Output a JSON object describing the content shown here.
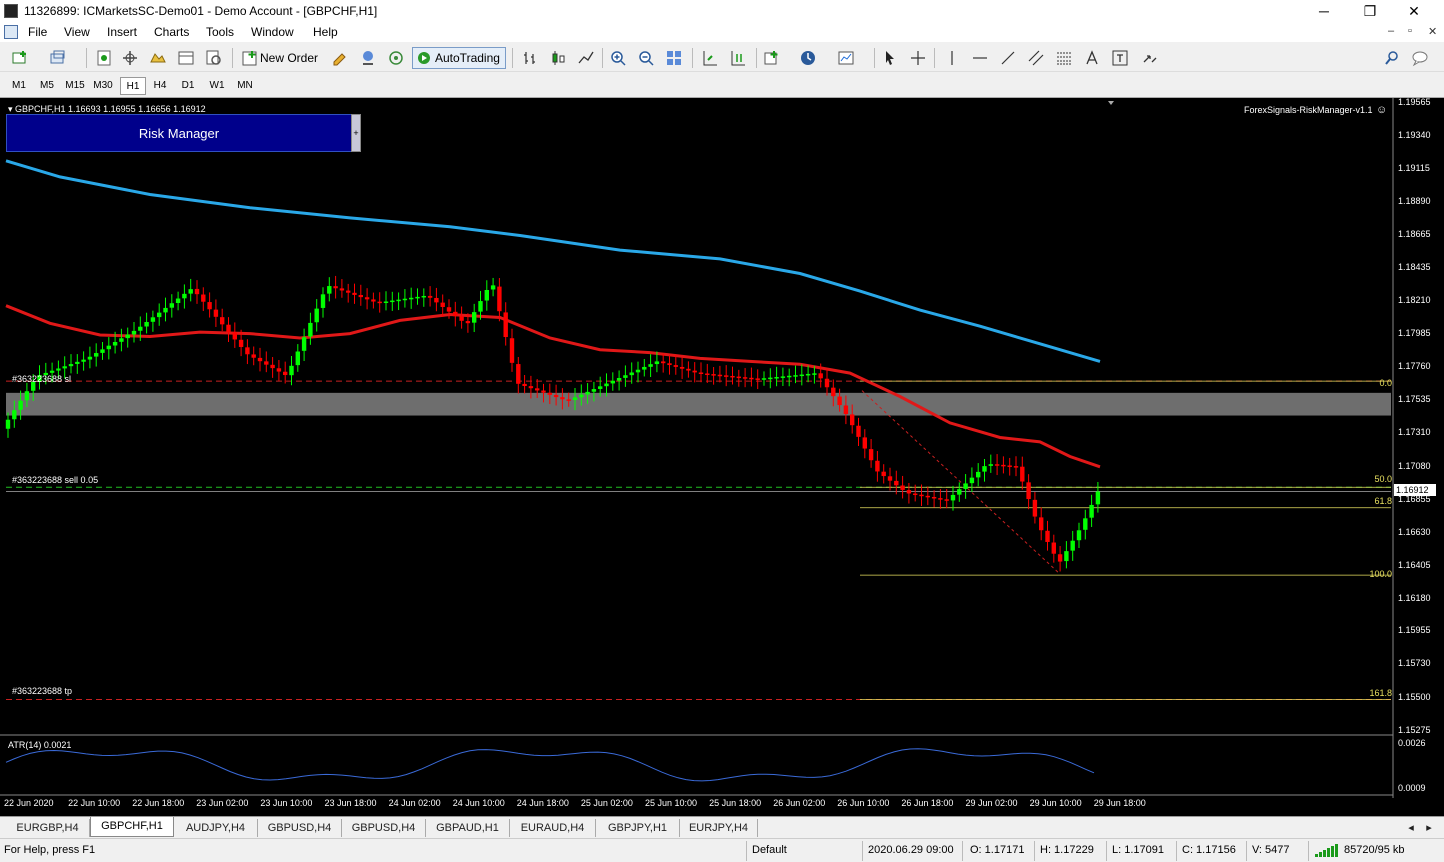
{
  "window": {
    "title": "11326899: ICMarketsSC-Demo01 - Demo Account - [GBPCHF,H1]",
    "minimize": "─",
    "restore": "❐",
    "close": "✕"
  },
  "menu": {
    "items": [
      "File",
      "View",
      "Insert",
      "Charts",
      "Tools",
      "Window",
      "Help"
    ],
    "mdi_min": "–",
    "mdi_restore": "▫",
    "mdi_close": "✕"
  },
  "toolbar": {
    "new_order": "New Order",
    "autotrading": "AutoTrading"
  },
  "timeframes": [
    "M1",
    "M5",
    "M15",
    "M30",
    "H1",
    "H4",
    "D1",
    "W1",
    "MN"
  ],
  "active_timeframe": "H1",
  "chart": {
    "header": "GBPCHF,H1  1.16693 1.16955 1.16656 1.16912",
    "indicator_name": "ForexSignals-RiskManager-v1.1",
    "risk_manager_label": "Risk Manager",
    "risk_toggle": "+",
    "current_price": "1.16912",
    "order_sl_label": "#363223688 sl",
    "order_sell_label": "#363223688 sell 0.05",
    "order_tp_label": "#363223688 tp",
    "atr_label": "ATR(14) 0.0021",
    "atr_levels": [
      "0.0026",
      "0.0009"
    ],
    "fib_levels": [
      "0.0",
      "50.0",
      "61.8",
      "100.0",
      "161.8"
    ],
    "price_axis": [
      "1.19565",
      "1.19340",
      "1.19115",
      "1.18890",
      "1.18665",
      "1.18435",
      "1.18210",
      "1.17985",
      "1.17760",
      "1.17535",
      "1.17310",
      "1.17080",
      "1.16855",
      "1.16630",
      "1.16405",
      "1.16180",
      "1.15955",
      "1.15730",
      "1.15500",
      "1.15275"
    ],
    "time_axis": [
      "22 Jun 2020",
      "22 Jun 10:00",
      "22 Jun 18:00",
      "23 Jun 02:00",
      "23 Jun 10:00",
      "23 Jun 18:00",
      "24 Jun 02:00",
      "24 Jun 10:00",
      "24 Jun 18:00",
      "25 Jun 02:00",
      "25 Jun 10:00",
      "25 Jun 18:00",
      "26 Jun 02:00",
      "26 Jun 10:00",
      "26 Jun 18:00",
      "29 Jun 02:00",
      "29 Jun 10:00",
      "29 Jun 18:00"
    ],
    "colors": {
      "bull": "#00ff00",
      "bear": "#ff0000",
      "ma_slow": "#2aa8e8",
      "ma_mid": "#e01818",
      "zone": "#6e6e6e",
      "atr": "#3a6ad8",
      "fib": "#e8e060"
    }
  },
  "tabs": [
    "EURGBP,H4",
    "GBPCHF,H1",
    "AUDJPY,H4",
    "GBPUSD,H4",
    "GBPUSD,H4",
    "GBPAUD,H1",
    "EURAUD,H4",
    "GBPJPY,H1",
    "EURJPY,H4"
  ],
  "active_tab": "GBPCHF,H1",
  "status": {
    "help": "For Help, press F1",
    "profile": "Default",
    "datetime": "2020.06.29 09:00",
    "open": "O: 1.17171",
    "high": "H: 1.17229",
    "low": "L: 1.17091",
    "close": "C: 1.17156",
    "volume": "V: 5477",
    "traffic": "85720/95 kb"
  }
}
